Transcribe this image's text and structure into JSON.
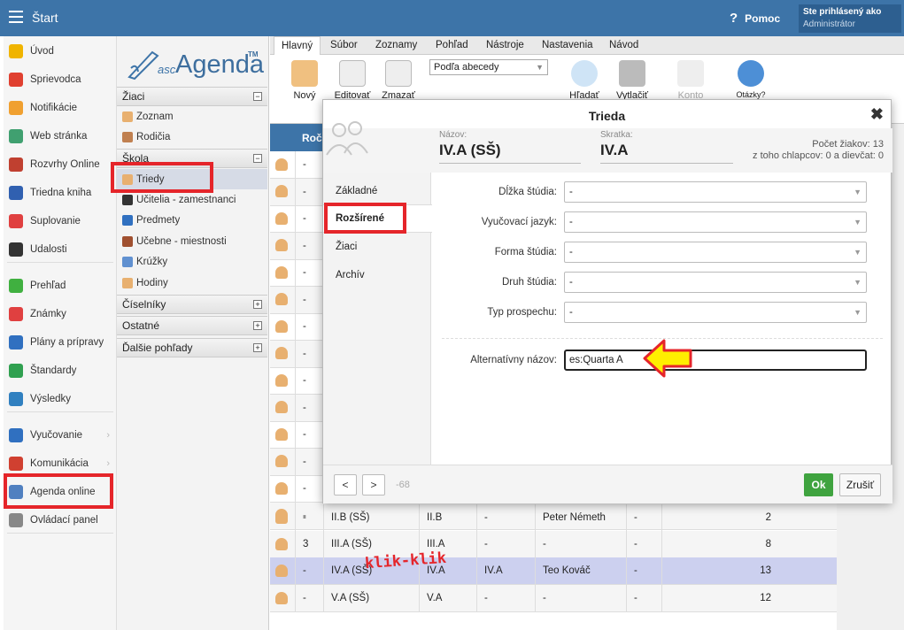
{
  "topbar": {
    "title": "Štart",
    "help": "Pomoc",
    "user_line1": "Ste prihlásený ako",
    "user_line2": "Administrátor"
  },
  "leftnav": {
    "items": [
      {
        "label": "Úvod",
        "icon": "star-icon",
        "color": "#f0b400"
      },
      {
        "label": "Sprievodca",
        "icon": "wand-icon",
        "color": "#e04030"
      },
      {
        "label": "Notifikácie",
        "icon": "envelope-icon",
        "color": "#f0a030"
      },
      {
        "label": "Web stránka",
        "icon": "home-icon",
        "color": "#40a070"
      },
      {
        "label": "Rozvrhy Online",
        "icon": "calendar-icon",
        "color": "#c04030"
      },
      {
        "label": "Triedna kniha",
        "icon": "book-icon",
        "color": "#3060b0"
      },
      {
        "label": "Suplovanie",
        "icon": "person-icon",
        "color": "#e04040"
      },
      {
        "label": "Udalosti",
        "icon": "list-icon",
        "color": "#333333"
      },
      {
        "label": "Prehľad",
        "icon": "check-circle-icon",
        "color": "#40b040"
      },
      {
        "label": "Známky",
        "icon": "grade-icon",
        "color": "#e04040"
      },
      {
        "label": "Plány a prípravy",
        "icon": "briefcase-icon",
        "color": "#3070c0"
      },
      {
        "label": "Štandardy",
        "icon": "shield-icon",
        "color": "#30a050"
      },
      {
        "label": "Výsledky",
        "icon": "bar-chart-icon",
        "color": "#3080c0"
      },
      {
        "label": "Vyučovanie",
        "icon": "open-book-icon",
        "color": "#3070c0"
      },
      {
        "label": "Komunikácia",
        "icon": "chat-icon",
        "color": "#d04030"
      },
      {
        "label": "Agenda online",
        "icon": "pen-icon",
        "color": "#5080c0"
      },
      {
        "label": "Ovládací panel",
        "icon": "gear-icon",
        "color": "#888888"
      }
    ]
  },
  "logo": {
    "asc": "asc",
    "agenda": "Agenda",
    "tm": "TM"
  },
  "subnav": {
    "sec_ziaci": "Žiaci",
    "zoznam": "Zoznam",
    "rodicia": "Rodičia",
    "sec_skola": "Škola",
    "triedy": "Triedy",
    "ucitelia": "Učitelia - zamestnanci",
    "predmety": "Predmety",
    "ucebne": "Učebne - miestnosti",
    "kruzky": "Krúžky",
    "hodiny": "Hodiny",
    "sec_ciselniky": "Číselníky",
    "sec_ostatne": "Ostatné",
    "sec_dalsie": "Ďalšie pohľady"
  },
  "ribbon": {
    "tabs": [
      "Hlavný",
      "Súbor",
      "Zoznamy",
      "Pohľad",
      "Nástroje",
      "Nastavenia",
      "Návod"
    ],
    "novy": "Nový",
    "editovat": "Editovať",
    "zmazat": "Zmazať",
    "sort": "Podľa abecedy",
    "hladat": "Hľadať",
    "vytlacit": "Vytlačiť",
    "konto": "Konto",
    "otazky": "Otázky?"
  },
  "grid": {
    "header_rocnik": "Roč",
    "rows_top": [
      "-",
      "-",
      "-",
      "-",
      "-",
      "-",
      "-",
      "-",
      "-",
      "-",
      "-",
      "-",
      "-",
      "-"
    ],
    "rows": [
      {
        "rocnik": "-",
        "nazov": "II.B (SŠ)",
        "skratka": "II.B",
        "c3": "-",
        "ucitel": "Peter Németh",
        "c5": "-",
        "pocet": "2"
      },
      {
        "rocnik": "3",
        "nazov": "III.A (SŠ)",
        "skratka": "III.A",
        "c3": "-",
        "ucitel": "-",
        "c5": "-",
        "pocet": "8"
      },
      {
        "rocnik": "-",
        "nazov": "IV.A (SŠ)",
        "skratka": "IV.A",
        "c3": "IV.A",
        "ucitel": "Teo Kováč",
        "c5": "-",
        "pocet": "13"
      },
      {
        "rocnik": "-",
        "nazov": "V.A (SŠ)",
        "skratka": "V.A",
        "c3": "-",
        "ucitel": "-",
        "c5": "-",
        "pocet": "12"
      }
    ]
  },
  "annotation": {
    "klik": "klik-klik"
  },
  "modal": {
    "title": "Trieda",
    "nazov_label": "Názov:",
    "nazov_value": "IV.A (SŠ)",
    "skratka_label": "Skratka:",
    "skratka_value": "IV.A",
    "stats_line1": "Počet žiakov: 13",
    "stats_line2": "z toho chlapcov: 0 a dievčat: 0",
    "tabs": [
      "Základné",
      "Rozšírené",
      "Žiaci",
      "Archív"
    ],
    "fields": [
      {
        "label": "Dĺžka štúdia:",
        "value": "-"
      },
      {
        "label": "Vyučovací jazyk:",
        "value": "-"
      },
      {
        "label": "Forma štúdia:",
        "value": "-"
      },
      {
        "label": "Druh štúdia:",
        "value": "-"
      },
      {
        "label": "Typ prospechu:",
        "value": "-"
      }
    ],
    "alt_label": "Alternatívny názov:",
    "alt_value": "es:Quarta A",
    "prev": "<",
    "next": ">",
    "record_id": "-68",
    "ok": "Ok",
    "cancel": "Zrušiť"
  }
}
